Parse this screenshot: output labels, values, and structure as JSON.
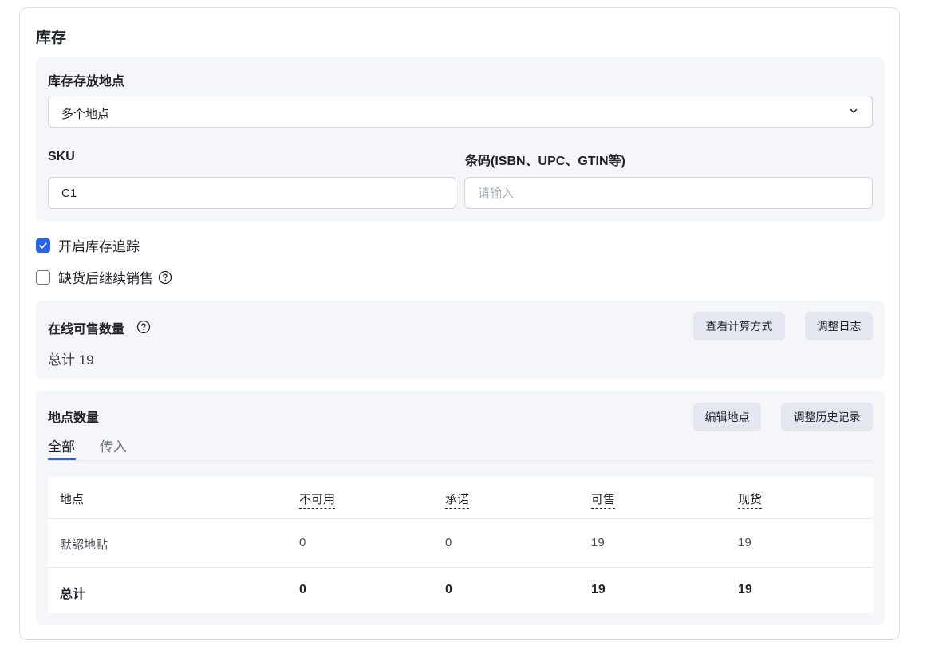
{
  "title": "库存",
  "storage": {
    "label": "库存存放地点",
    "selected": "多个地点"
  },
  "sku": {
    "label": "SKU",
    "value": "C1"
  },
  "barcode": {
    "label": "条码(ISBN、UPC、GTIN等)",
    "value": "",
    "placeholder": "请输入"
  },
  "checkboxes": [
    {
      "label": "开启库存追踪",
      "checked": true
    },
    {
      "label": "缺货后继续销售",
      "checked": false
    }
  ],
  "online": {
    "label": "在线可售数量",
    "total": "总计 19",
    "btn_calc": "查看计算方式",
    "btn_log": "调整日志"
  },
  "location_qty": {
    "label": "地点数量",
    "btn_edit": "编辑地点",
    "btn_history": "调整历史记录",
    "tabs": [
      "全部",
      "传入"
    ],
    "table": {
      "headers": [
        "地点",
        "不可用",
        "承诺",
        "可售",
        "现货"
      ],
      "rows": [
        [
          "默認地點",
          "0",
          "0",
          "19",
          "19"
        ]
      ],
      "total_row": [
        "总计",
        "0",
        "0",
        "19",
        "19"
      ]
    }
  },
  "colors": {
    "accent": "#2563eb",
    "panel": "#f5f6fa",
    "button": "#e5e7f0"
  }
}
